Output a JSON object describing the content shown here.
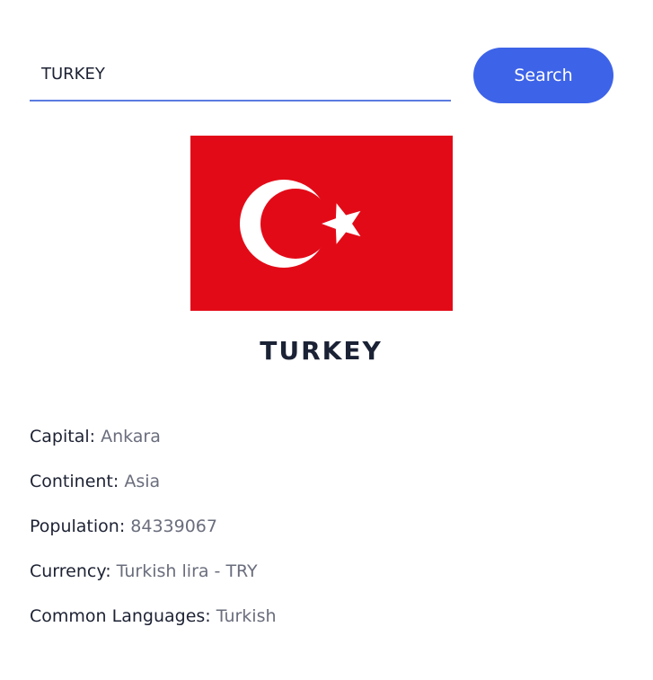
{
  "search": {
    "value": "TURKEY",
    "button_label": "Search"
  },
  "country": {
    "name": "TURKEY",
    "flag": {
      "icon": "turkey-flag-icon",
      "background_color": "#e30a17",
      "symbol_color": "#ffffff"
    }
  },
  "details": [
    {
      "label": "Capital:",
      "value": "Ankara"
    },
    {
      "label": "Continent:",
      "value": "Asia"
    },
    {
      "label": "Population:",
      "value": "84339067"
    },
    {
      "label": "Currency:",
      "value": "Turkish lira - TRY"
    },
    {
      "label": "Common Languages:",
      "value": "Turkish"
    }
  ],
  "colors": {
    "accent": "#3d63e8",
    "text": "#1d2233",
    "muted": "#6a6d7c"
  }
}
